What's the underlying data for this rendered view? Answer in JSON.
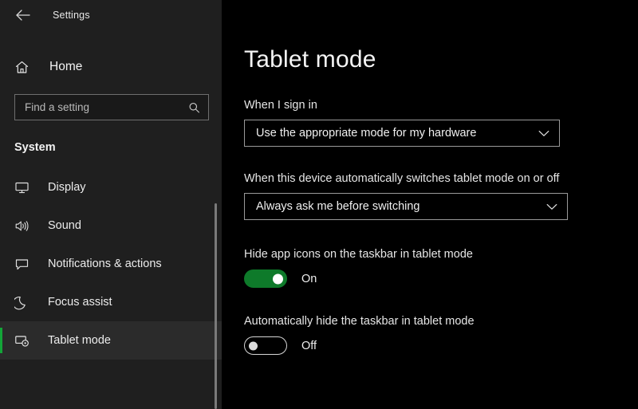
{
  "colors": {
    "accent_green": "#13a538",
    "accent_green_dark": "#0e7a2a",
    "sidebar_bg": "#1f1f1f",
    "main_bg": "#000000",
    "selected_bg": "#2b2b2b",
    "text_primary": "#f2f2f2"
  },
  "titlebar": {
    "back_icon": "back-arrow-icon",
    "app_title": "Settings"
  },
  "sidebar": {
    "home": {
      "icon": "home-icon",
      "label": "Home"
    },
    "search": {
      "value": "",
      "placeholder": "Find a setting",
      "icon": "search-icon"
    },
    "section_heading": "System",
    "items": [
      {
        "icon": "monitor-icon",
        "label": "Display",
        "selected": false
      },
      {
        "icon": "speaker-icon",
        "label": "Sound",
        "selected": false
      },
      {
        "icon": "chat-bubble-icon",
        "label": "Notifications & actions",
        "selected": false
      },
      {
        "icon": "moon-icon",
        "label": "Focus assist",
        "selected": false
      },
      {
        "icon": "tablet-icon",
        "label": "Tablet mode",
        "selected": true
      }
    ]
  },
  "main": {
    "page_title": "Tablet mode",
    "sign_in": {
      "label": "When I sign in",
      "selected_value": "Use the appropriate mode for my hardware",
      "chevron_icon": "chevron-down-icon"
    },
    "auto_switch": {
      "label": "When this device automatically switches tablet mode on or off",
      "selected_value": "Always ask me before switching",
      "chevron_icon": "chevron-down-icon"
    },
    "hide_app_icons": {
      "label": "Hide app icons on the taskbar in tablet mode",
      "state": "On",
      "checked": true
    },
    "auto_hide_taskbar": {
      "label": "Automatically hide the taskbar in tablet mode",
      "state": "Off",
      "checked": false
    }
  }
}
